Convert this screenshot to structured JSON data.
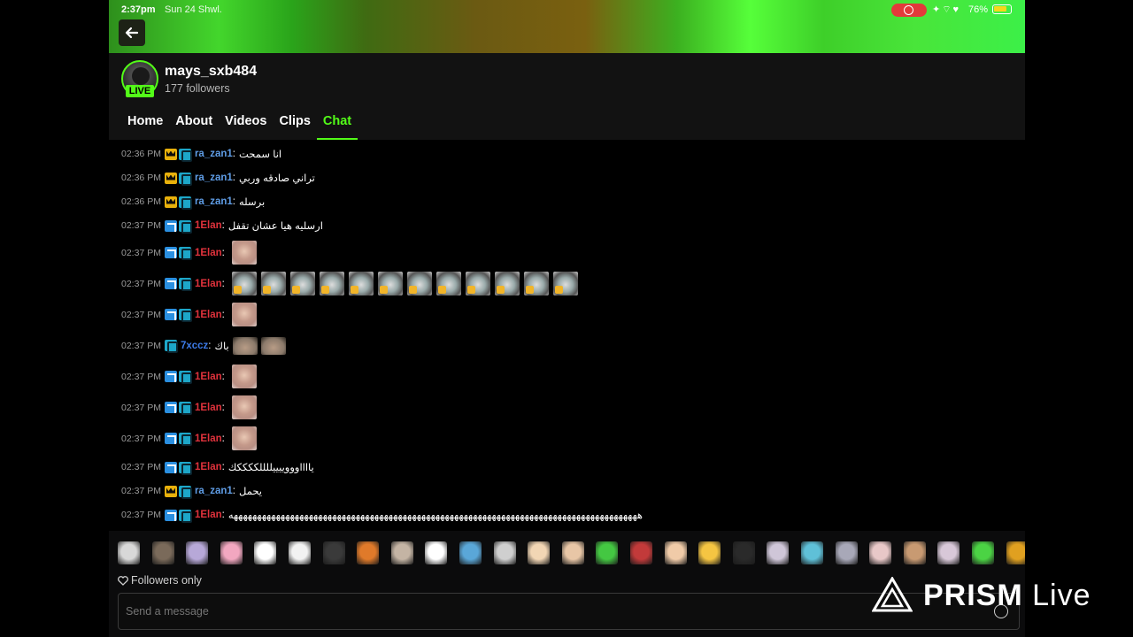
{
  "status_bar": {
    "time": "2:37pm",
    "date": "Sun 24 Shwl.",
    "battery": "76%",
    "battery_level": 0.76,
    "icons": [
      "record-icon",
      "location-icon",
      "wifi-icon",
      "heart-icon",
      "battery-icon"
    ]
  },
  "channel": {
    "name": "mays_sxb484",
    "followers": "177 followers",
    "live_label": "LIVE"
  },
  "tabs": [
    {
      "label": "Home",
      "active": false
    },
    {
      "label": "About",
      "active": false
    },
    {
      "label": "Videos",
      "active": false
    },
    {
      "label": "Clips",
      "active": false
    },
    {
      "label": "Chat",
      "active": true
    }
  ],
  "chat": {
    "messages": [
      {
        "time": "02:36 PM",
        "badges": [
          "crown",
          "sub"
        ],
        "user": "ra_zan1",
        "text": "انا سمحت",
        "emotes": 0
      },
      {
        "time": "02:36 PM",
        "badges": [
          "crown",
          "sub"
        ],
        "user": "ra_zan1",
        "text": "تراني صادقه وربي",
        "emotes": 0
      },
      {
        "time": "02:36 PM",
        "badges": [
          "crown",
          "sub"
        ],
        "user": "ra_zan1",
        "text": "برسله",
        "emotes": 0
      },
      {
        "time": "02:37 PM",
        "badges": [
          "hammer",
          "sub"
        ],
        "user": "1Elan",
        "text": "ارسليه هيا عشان تقفل",
        "emotes": 0
      },
      {
        "time": "02:37 PM",
        "badges": [
          "hammer",
          "sub"
        ],
        "user": "1Elan",
        "text": "",
        "emotes": 1
      },
      {
        "time": "02:37 PM",
        "badges": [
          "hammer",
          "sub"
        ],
        "user": "1Elan",
        "text": "",
        "emotes": 12
      },
      {
        "time": "02:37 PM",
        "badges": [
          "hammer",
          "sub"
        ],
        "user": "1Elan",
        "text": "",
        "emotes": 1
      },
      {
        "time": "02:37 PM",
        "badges": [
          "sub"
        ],
        "user": "7xccz",
        "text": "باك",
        "emotes": 2
      },
      {
        "time": "02:37 PM",
        "badges": [
          "hammer",
          "sub"
        ],
        "user": "1Elan",
        "text": "",
        "emotes": 1
      },
      {
        "time": "02:37 PM",
        "badges": [
          "hammer",
          "sub"
        ],
        "user": "1Elan",
        "text": "",
        "emotes": 1
      },
      {
        "time": "02:37 PM",
        "badges": [
          "hammer",
          "sub"
        ],
        "user": "1Elan",
        "text": "",
        "emotes": 1
      },
      {
        "time": "02:37 PM",
        "badges": [
          "hammer",
          "sub"
        ],
        "user": "1Elan",
        "text": "يااااوووييييللللككككك",
        "emotes": 0
      },
      {
        "time": "02:37 PM",
        "badges": [
          "crown",
          "sub"
        ],
        "user": "ra_zan1",
        "text": "يحمل",
        "emotes": 0
      },
      {
        "time": "02:37 PM",
        "badges": [
          "hammer",
          "sub"
        ],
        "user": "1Elan",
        "text": "هههههههههههههههههههههههههههههههههههههههههههههههههههههههههههههههههههههههههههههههههههههههه",
        "emotes": 0
      }
    ]
  },
  "emote_bar": {
    "colors": [
      "#d8d8d8",
      "#7a6a5a",
      "#b7a8d8",
      "#f2a7c0",
      "#ffffff",
      "#f2f2f2",
      "#3a3a3a",
      "#e07a2a",
      "#c4b4a4",
      "#ffffff",
      "#5aa7d8",
      "#cfcfcf",
      "#f2d6b4",
      "#e8c6a6",
      "#44c742",
      "#c23a3a",
      "#f0cba8",
      "#f5c542",
      "#2a2a2a",
      "#cfc6d8",
      "#5fc0d8",
      "#a8a8b8",
      "#e8c8c8",
      "#c89a72",
      "#d8c8d8",
      "#4bd344",
      "#e0a020"
    ]
  },
  "followers_only_label": "Followers only",
  "send_placeholder": "Send a message",
  "watermark": {
    "brand": "PRISM",
    "suffix": "Live"
  },
  "colors": {
    "accent": "#53fc18",
    "user_ra": "#5f9de6",
    "user_elan": "#e0323c",
    "user_xccz": "#3d7be8"
  }
}
